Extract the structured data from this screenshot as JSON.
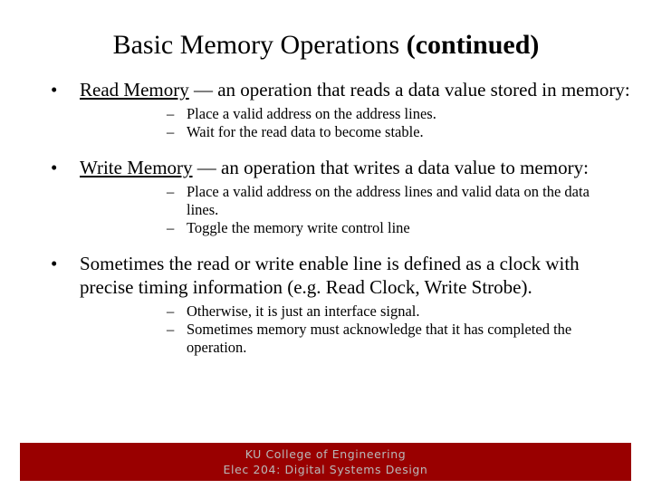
{
  "slide": {
    "title_main": "Basic Memory Operations ",
    "title_bold": "(continued)",
    "background_color": "#ffffff",
    "text_color": "#000000"
  },
  "content": {
    "bullets": [
      {
        "marker": "•",
        "term": "Read Memory",
        "text": " — an operation that reads a data value stored in memory:",
        "sub_marker_1": "–",
        "sub_1": "Place a valid address on the address lines.",
        "sub_marker_2": "–",
        "sub_2": "Wait for the read data to become stable."
      },
      {
        "marker": "•",
        "term": "Write Memory",
        "text": " — an operation that writes a data value to memory:",
        "sub_marker_1": "–",
        "sub_1": "Place a valid address on the address lines and valid data on the data lines.",
        "sub_marker_2": "–",
        "sub_2": "Toggle the memory write control line"
      },
      {
        "marker": "•",
        "term": "",
        "text": "Sometimes the read or write enable line is defined as a clock with precise timing information (e.g. Read Clock, Write Strobe).",
        "sub_marker_1": "–",
        "sub_1": "Otherwise, it is just an interface signal.",
        "sub_marker_2": "–",
        "sub_2": "Sometimes memory must acknowledge that it has completed the operation."
      }
    ]
  },
  "footer": {
    "line1": "KU College of Engineering",
    "line2": "Elec 204: Digital Systems Design",
    "bar_color": "#990000",
    "text_color": "#b9b9b9"
  }
}
